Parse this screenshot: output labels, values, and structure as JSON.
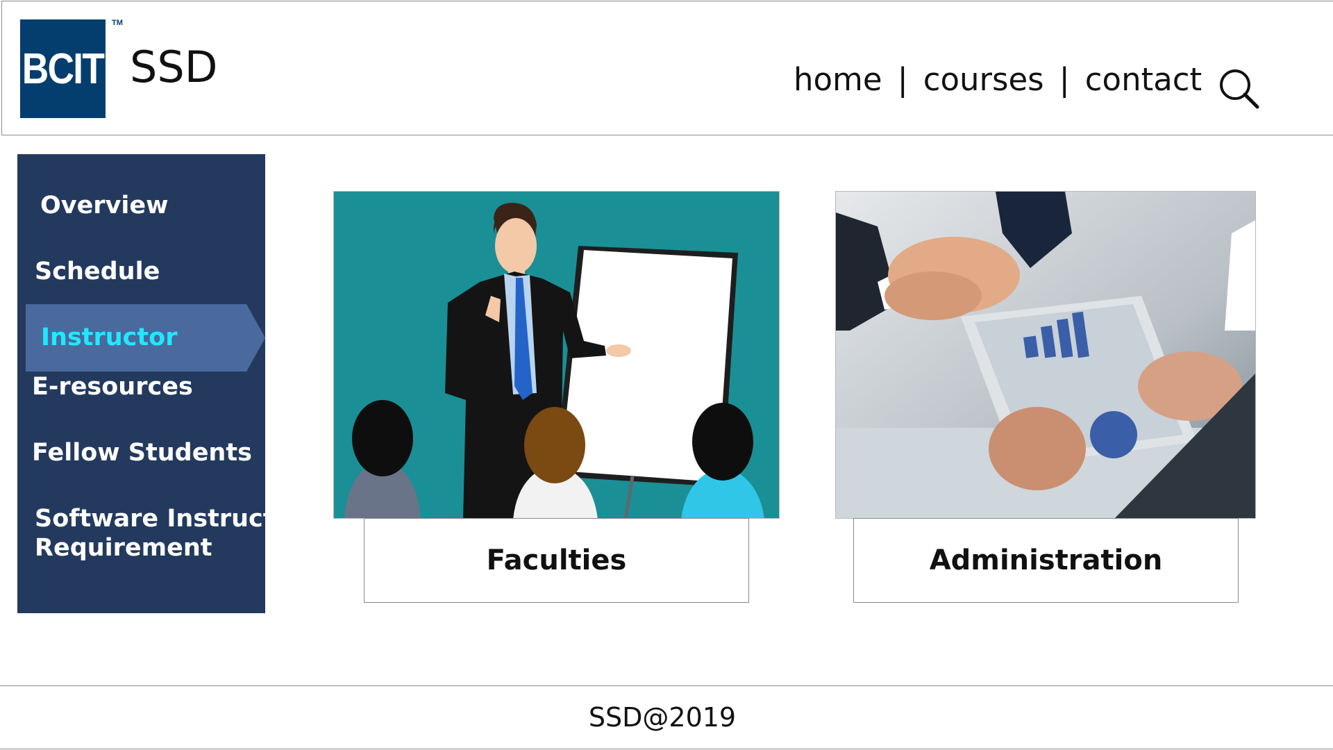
{
  "header": {
    "logo_text": "BCIT",
    "logo_tm": "TM",
    "site_title": "SSD",
    "nav": [
      {
        "label": "home"
      },
      {
        "label": "courses"
      },
      {
        "label": "contact"
      }
    ],
    "nav_separator": "|",
    "search_icon": "search-icon"
  },
  "sidebar": {
    "items": [
      {
        "label": "Overview"
      },
      {
        "label": "Schedule"
      },
      {
        "label": "Instructor",
        "active": true
      },
      {
        "label": "E-resources"
      },
      {
        "label": "Fellow Students"
      },
      {
        "label": "Software Instructor"
      },
      {
        "label": "Requirement"
      }
    ]
  },
  "cards": [
    {
      "label": "Faculties",
      "image": "presentation-illustration"
    },
    {
      "label": "Administration",
      "image": "handshake-photo"
    }
  ],
  "footer": {
    "text": "SSD@2019"
  },
  "colors": {
    "logo_bg": "#043e6e",
    "sidebar_bg": "#233a5e",
    "sidebar_active_bg": "#4a6a9e",
    "sidebar_active_text": "#22e8ff",
    "illustration_bg": "#1b8f96"
  }
}
